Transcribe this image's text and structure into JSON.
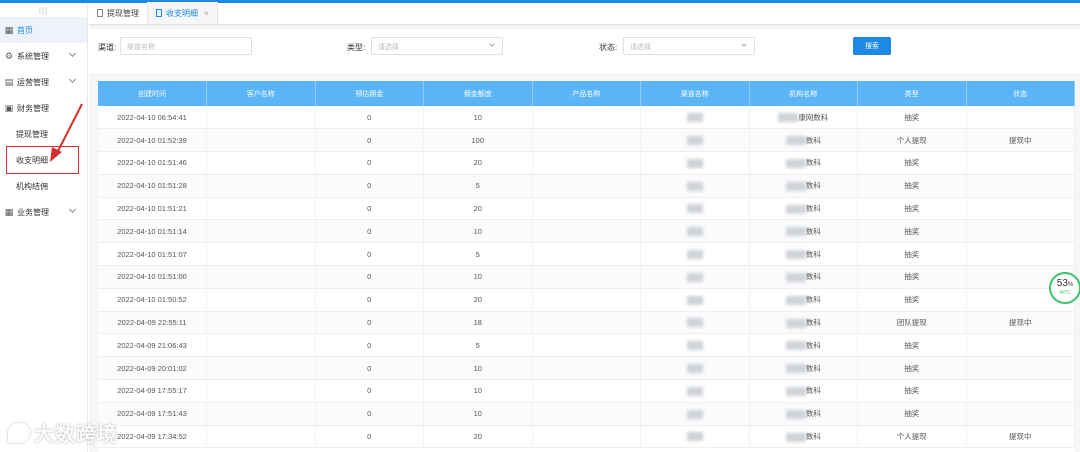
{
  "sidebar": {
    "handle": "|||",
    "home": "首页",
    "items": [
      {
        "label": "系统管理"
      },
      {
        "label": "运营管理"
      },
      {
        "label": "财务管理"
      }
    ],
    "sub_items": [
      {
        "label": "提现管理"
      },
      {
        "label": "收支明细"
      },
      {
        "label": "机构结佣"
      }
    ],
    "business": "业务管理"
  },
  "tabs": [
    {
      "label": "提现管理"
    },
    {
      "label": "收支明细"
    }
  ],
  "tab_close": "×",
  "filters": {
    "channel_label": "渠道:",
    "channel_placeholder": "渠道名称",
    "type_label": "类型:",
    "type_placeholder": "请选择",
    "status_label": "状态:",
    "status_placeholder": "请选择",
    "search_label": "搜索"
  },
  "table": {
    "columns": [
      "创建时间",
      "客户名称",
      "预估佣金",
      "佣金额度",
      "产品名称",
      "渠道名称",
      "机构名称",
      "类型",
      "状态"
    ],
    "rows": [
      {
        "time": "2022-04-10 06:54:41",
        "est": "0",
        "amount": "10",
        "org": "康网数科",
        "type": "抽奖",
        "status": ""
      },
      {
        "time": "2022-04-10 01:52:39",
        "est": "0",
        "amount": "100",
        "org": "数科",
        "type": "个人提现",
        "status": "提现中"
      },
      {
        "time": "2022-04-10 01:51:46",
        "est": "0",
        "amount": "20",
        "org": "数科",
        "type": "抽奖",
        "status": ""
      },
      {
        "time": "2022-04-10 01:51:28",
        "est": "0",
        "amount": "5",
        "org": "数科",
        "type": "抽奖",
        "status": ""
      },
      {
        "time": "2022-04-10 01:51:21",
        "est": "0",
        "amount": "20",
        "org": "数科",
        "type": "抽奖",
        "status": ""
      },
      {
        "time": "2022-04-10 01:51:14",
        "est": "0",
        "amount": "10",
        "org": "数科",
        "type": "抽奖",
        "status": ""
      },
      {
        "time": "2022-04-10 01:51:07",
        "est": "0",
        "amount": "5",
        "org": "数科",
        "type": "抽奖",
        "status": ""
      },
      {
        "time": "2022-04-10 01:51:00",
        "est": "0",
        "amount": "10",
        "org": "数科",
        "type": "抽奖",
        "status": ""
      },
      {
        "time": "2022-04-10 01:50:52",
        "est": "0",
        "amount": "20",
        "org": "数科",
        "type": "抽奖",
        "status": ""
      },
      {
        "time": "2022-04-09 22:55:11",
        "est": "0",
        "amount": "18",
        "org": "数科",
        "type": "团队提现",
        "status": "提现中"
      },
      {
        "time": "2022-04-09 21:06:43",
        "est": "0",
        "amount": "5",
        "org": "数科",
        "type": "抽奖",
        "status": ""
      },
      {
        "time": "2022-04-09 20:01:02",
        "est": "0",
        "amount": "10",
        "org": "数科",
        "type": "抽奖",
        "status": ""
      },
      {
        "time": "2022-04-09 17:55:17",
        "est": "0",
        "amount": "10",
        "org": "数科",
        "type": "抽奖",
        "status": ""
      },
      {
        "time": "2022-04-09 17:51:43",
        "est": "0",
        "amount": "10",
        "org": "数科",
        "type": "抽奖",
        "status": ""
      },
      {
        "time": "2022-04-09 17:34:52",
        "est": "0",
        "amount": "20",
        "org": "数科",
        "type": "个人提现",
        "status": "提现中"
      }
    ]
  },
  "badge": {
    "percent": "53",
    "unit": "%",
    "temp": "44°C"
  },
  "watermark": "大数跨境",
  "colors": {
    "accent": "#1e88e5",
    "header": "#5bb4f5",
    "annotation": "#d32f2f",
    "badge": "#3ec46d"
  }
}
